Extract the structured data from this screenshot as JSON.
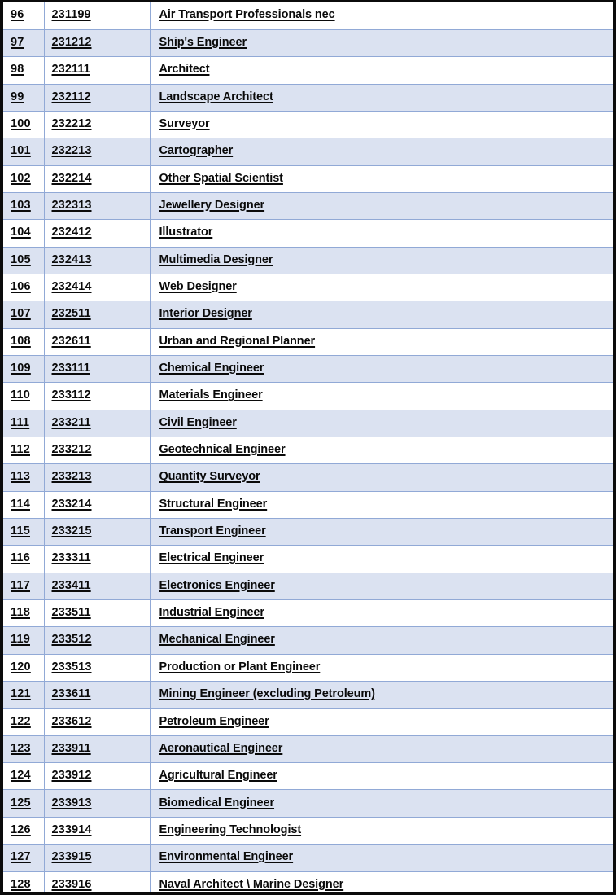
{
  "document": {
    "kind": "spreadsheet-table-screenshot",
    "style": {
      "shaded_row_color": "#dbe2f1",
      "plain_row_color": "#ffffff",
      "gridline_color": "#91a9d6",
      "outer_border_color": "#0b0b0b",
      "text_color": "#0a0a0a"
    }
  },
  "table": {
    "columns": [
      {
        "key": "index",
        "name": "row-number-column"
      },
      {
        "key": "code",
        "name": "anzsco-code-column"
      },
      {
        "key": "title",
        "name": "occupation-title-column"
      }
    ],
    "rows": [
      {
        "index": "96",
        "code": "231199",
        "title": "Air Transport Professionals nec",
        "shaded": false
      },
      {
        "index": "97",
        "code": "231212",
        "title": "Ship's Engineer",
        "shaded": true
      },
      {
        "index": "98",
        "code": "232111",
        "title": "Architect",
        "shaded": false
      },
      {
        "index": "99",
        "code": "232112",
        "title": "Landscape Architect",
        "shaded": true
      },
      {
        "index": "100",
        "code": "232212",
        "title": "Surveyor",
        "shaded": false
      },
      {
        "index": "101",
        "code": "232213",
        "title": "Cartographer",
        "shaded": true
      },
      {
        "index": "102",
        "code": "232214",
        "title": "Other Spatial Scientist",
        "shaded": false
      },
      {
        "index": "103",
        "code": "232313",
        "title": "Jewellery Designer",
        "shaded": true
      },
      {
        "index": "104",
        "code": "232412",
        "title": "Illustrator",
        "shaded": false
      },
      {
        "index": "105",
        "code": "232413",
        "title": "Multimedia Designer",
        "shaded": true
      },
      {
        "index": "106",
        "code": "232414",
        "title": "Web Designer",
        "shaded": false
      },
      {
        "index": "107",
        "code": "232511",
        "title": "Interior Designer",
        "shaded": true
      },
      {
        "index": "108",
        "code": "232611",
        "title": "Urban and Regional Planner",
        "shaded": false
      },
      {
        "index": "109",
        "code": "233111",
        "title": "Chemical Engineer",
        "shaded": true
      },
      {
        "index": "110",
        "code": "233112",
        "title": "Materials Engineer",
        "shaded": false
      },
      {
        "index": "111",
        "code": "233211",
        "title": "Civil Engineer",
        "shaded": true
      },
      {
        "index": "112",
        "code": "233212",
        "title": "Geotechnical Engineer",
        "shaded": false
      },
      {
        "index": "113",
        "code": "233213",
        "title": "Quantity Surveyor",
        "shaded": true
      },
      {
        "index": "114",
        "code": "233214",
        "title": "Structural Engineer",
        "shaded": false
      },
      {
        "index": "115",
        "code": "233215",
        "title": "Transport Engineer",
        "shaded": true
      },
      {
        "index": "116",
        "code": "233311",
        "title": "Electrical Engineer",
        "shaded": false
      },
      {
        "index": "117",
        "code": "233411",
        "title": "Electronics Engineer",
        "shaded": true
      },
      {
        "index": "118",
        "code": "233511",
        "title": "Industrial Engineer",
        "shaded": false
      },
      {
        "index": "119",
        "code": "233512",
        "title": "Mechanical Engineer",
        "shaded": true
      },
      {
        "index": "120",
        "code": "233513",
        "title": "Production or Plant Engineer",
        "shaded": false
      },
      {
        "index": "121",
        "code": "233611",
        "title": "Mining Engineer (excluding Petroleum)",
        "shaded": true
      },
      {
        "index": "122",
        "code": "233612",
        "title": "Petroleum Engineer",
        "shaded": false
      },
      {
        "index": "123",
        "code": "233911",
        "title": "Aeronautical Engineer",
        "shaded": true
      },
      {
        "index": "124",
        "code": "233912",
        "title": "Agricultural Engineer",
        "shaded": false
      },
      {
        "index": "125",
        "code": "233913",
        "title": "Biomedical Engineer",
        "shaded": true
      },
      {
        "index": "126",
        "code": "233914",
        "title": "Engineering Technologist",
        "shaded": false
      },
      {
        "index": "127",
        "code": "233915",
        "title": "Environmental Engineer",
        "shaded": true
      },
      {
        "index": "128",
        "code": "233916",
        "title": "Naval Architect \\ Marine Designer",
        "shaded": false
      }
    ]
  }
}
